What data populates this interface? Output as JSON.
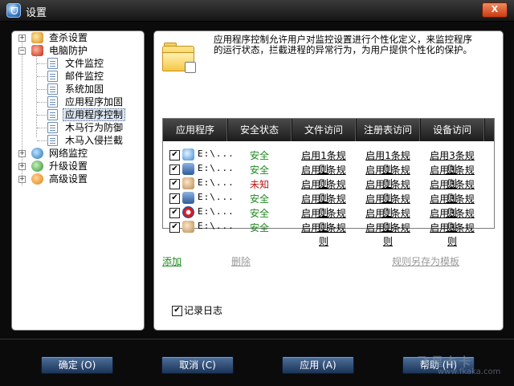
{
  "window": {
    "title": "设置",
    "close_label": "X"
  },
  "tree": [
    {
      "label": "查杀设置",
      "icon": "search-icon",
      "expander": "+"
    },
    {
      "label": "电脑防护",
      "icon": "shield-icon",
      "expander": "−"
    },
    {
      "label": "文件监控",
      "icon": "document-icon"
    },
    {
      "label": "邮件监控",
      "icon": "document-icon"
    },
    {
      "label": "系统加固",
      "icon": "document-icon"
    },
    {
      "label": "应用程序加固",
      "icon": "document-icon"
    },
    {
      "label": "应用程序控制",
      "icon": "document-icon",
      "selected": true
    },
    {
      "label": "木马行为防御",
      "icon": "document-icon"
    },
    {
      "label": "木马入侵拦截",
      "icon": "document-icon"
    },
    {
      "label": "网络监控",
      "icon": "network-icon",
      "expander": "+"
    },
    {
      "label": "升级设置",
      "icon": "upgrade-icon",
      "expander": "+"
    },
    {
      "label": "高级设置",
      "icon": "gear-icon",
      "expander": "+"
    }
  ],
  "description": "应用程序控制允许用户对监控设置进行个性化定义，来监控程序的运行状态，拦截进程的异常行为，为用户提供个性化的保护。",
  "table": {
    "headers": [
      "应用程序",
      "安全状态",
      "文件访问",
      "注册表访问",
      "设备访问"
    ],
    "rows": [
      {
        "checked": "✔",
        "path": "E:\\...",
        "status": "安全",
        "status_kind": "safe",
        "file": "启用1条规则",
        "registry": "启用1条规则",
        "device": "启用3条规则"
      },
      {
        "checked": "✔",
        "path": "E:\\...",
        "status": "安全",
        "status_kind": "safe",
        "file": "启用1条规则",
        "registry": "启用1条规则",
        "device": "启用3条规则"
      },
      {
        "checked": "✔",
        "path": "E:\\...",
        "status": "未知",
        "status_kind": "unknown",
        "file": "启用1条规则",
        "registry": "启用1条规则",
        "device": "启用3条规则"
      },
      {
        "checked": "✔",
        "path": "E:\\...",
        "status": "安全",
        "status_kind": "safe",
        "file": "启用1条规则",
        "registry": "启用1条规则",
        "device": "启用3条规则"
      },
      {
        "checked": "✔",
        "path": "E:\\...",
        "status": "安全",
        "status_kind": "safe",
        "file": "启用1条规则",
        "registry": "启用1条规则",
        "device": "启用3条规则"
      },
      {
        "checked": "✔",
        "path": "E:\\...",
        "status": "安全",
        "status_kind": "safe",
        "file": "启用1条规则",
        "registry": "启用1条规则",
        "device": "启用3条规则"
      }
    ]
  },
  "actions": {
    "add": "添加",
    "delete": "删除",
    "save_template": "规则另存为模板"
  },
  "log": {
    "checked": "✔",
    "label": "记录日志"
  },
  "buttons": {
    "ok": "确定 (O)",
    "cancel": "取消 (C)",
    "apply": "应用 (A)",
    "help": "帮助 (H)"
  },
  "watermark": {
    "brand": "飞星卡卡",
    "url": "www.fkaka.com"
  },
  "colors": {
    "safe": "#1c8a1c",
    "unknown": "#c01313",
    "add_link": "#1d8a1d",
    "disabled_link": "#9a9a9a",
    "button": "#2c4a75"
  }
}
